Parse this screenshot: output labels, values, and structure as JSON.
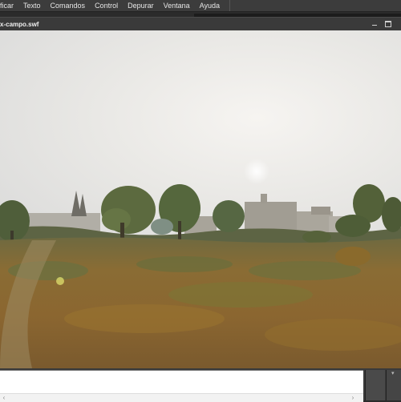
{
  "menu": {
    "items": [
      {
        "label": "ificar"
      },
      {
        "label": "Texto"
      },
      {
        "label": "Comandos"
      },
      {
        "label": "Control"
      },
      {
        "label": "Depurar"
      },
      {
        "label": "Ventana"
      },
      {
        "label": "Ayuda"
      }
    ]
  },
  "document": {
    "tab_title": "x-campo.swf"
  },
  "window_controls": {
    "minimize_icon": "minimize-icon",
    "maximize_icon": "restore-icon"
  },
  "stage": {
    "content": "photo of a dry grass field with trees and town buildings under a hazy sky"
  },
  "colors": {
    "chrome_dark": "#2b2b2b",
    "menu_bg": "#3c3c3c",
    "tab_bg": "#3a3a3a",
    "sky": "#ebebe9",
    "field": "#8a6a2c"
  }
}
